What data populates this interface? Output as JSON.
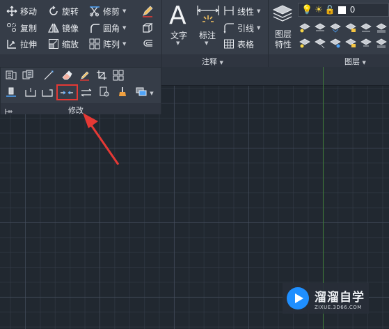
{
  "ribbon": {
    "modify": {
      "rows": [
        [
          {
            "label": "移动",
            "icon": "move-icon"
          },
          {
            "label": "旋转",
            "icon": "rotate-icon"
          },
          {
            "label": "修剪",
            "icon": "trim-icon",
            "dropdown": true
          }
        ],
        [
          {
            "label": "复制",
            "icon": "copy-icon"
          },
          {
            "label": "镜像",
            "icon": "mirror-icon"
          },
          {
            "label": "圆角",
            "icon": "fillet-icon",
            "dropdown": true
          }
        ],
        [
          {
            "label": "拉伸",
            "icon": "stretch-icon"
          },
          {
            "label": "缩放",
            "icon": "scale-icon"
          },
          {
            "label": "阵列",
            "icon": "array-icon",
            "dropdown": true
          }
        ]
      ],
      "title": "修改"
    },
    "annotation": {
      "text_label": "文字",
      "dimension_label": "标注",
      "linear_label": "线性",
      "leader_label": "引线",
      "table_label": "表格",
      "title": "注释"
    },
    "layers": {
      "layer_properties_label": "图层\n特性",
      "layer_properties_line1": "图层",
      "layer_properties_line2": "特性",
      "current_layer": "0",
      "title": "图层"
    }
  },
  "colors": {
    "ribbon_bg": "#363d48",
    "canvas_bg": "#212830",
    "highlight": "#e53935",
    "arrow": "#e53935",
    "y_axis": "#3f7a3a"
  },
  "watermark": {
    "name": "溜溜自学",
    "url": "ZIXUE.3D66.COM"
  }
}
